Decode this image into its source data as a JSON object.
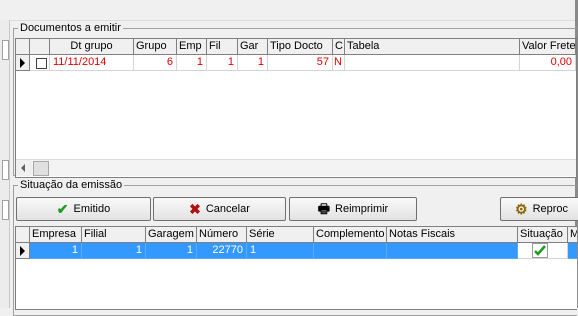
{
  "sections": {
    "documents": "Documentos a emitir",
    "emission": "Situação da emissão"
  },
  "documents_grid": {
    "columns": [
      "Dt grupo",
      "Grupo",
      "Emp",
      "Fil",
      "Gar",
      "Tipo Docto",
      "C",
      "Tabela",
      "Valor Frete"
    ],
    "row": {
      "checked": false,
      "dt_grupo": "11/11/2014",
      "grupo": "6",
      "emp": "1",
      "fil": "1",
      "gar": "1",
      "tipo_docto": "57",
      "c": "N",
      "tabela": "",
      "valor_frete": "0,00"
    }
  },
  "buttons": {
    "emitido": "Emitido",
    "cancelar": "Cancelar",
    "reimprimir": "Reimprimir",
    "reprocessar": "Reproc"
  },
  "emission_grid": {
    "columns": [
      "Empresa",
      "Filial",
      "Garagem",
      "Número",
      "Série",
      "Complemento",
      "Notas Fiscais",
      "Situação",
      "Mot"
    ],
    "row": {
      "empresa": "1",
      "filial": "1",
      "garagem": "1",
      "numero": "22770",
      "serie": "1",
      "complemento": "",
      "notas_fiscais": "",
      "situacao": "check-icon"
    }
  },
  "colors": {
    "selection": "#3399ff",
    "red_text": "#e00000",
    "check_green": "#1f9d1f"
  }
}
